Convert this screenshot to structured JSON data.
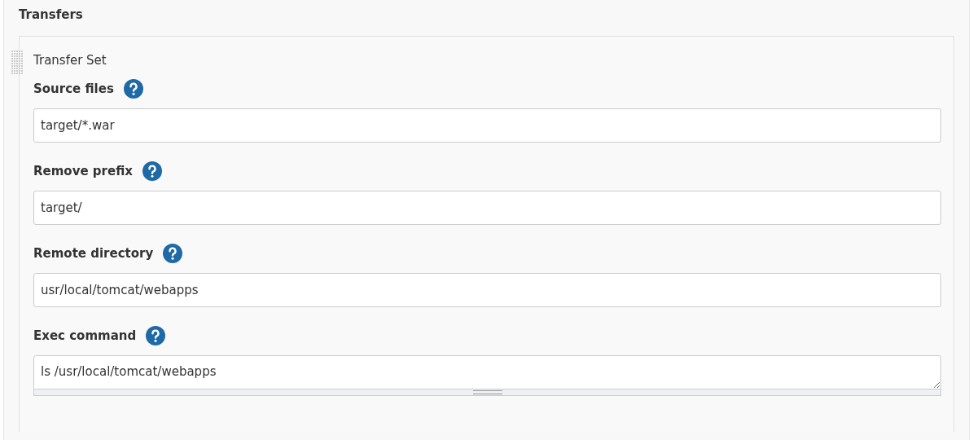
{
  "section": {
    "title": "Transfers"
  },
  "transfer_set": {
    "title": "Transfer Set",
    "fields": [
      {
        "label": "Source files",
        "kind": "input",
        "value": "target/*.war"
      },
      {
        "label": "Remove prefix",
        "kind": "input",
        "value": "target/"
      },
      {
        "label": "Remote directory",
        "kind": "input",
        "value": "usr/local/tomcat/webapps"
      },
      {
        "label": "Exec command",
        "kind": "textarea",
        "value": "ls /usr/local/tomcat/webapps"
      }
    ]
  }
}
